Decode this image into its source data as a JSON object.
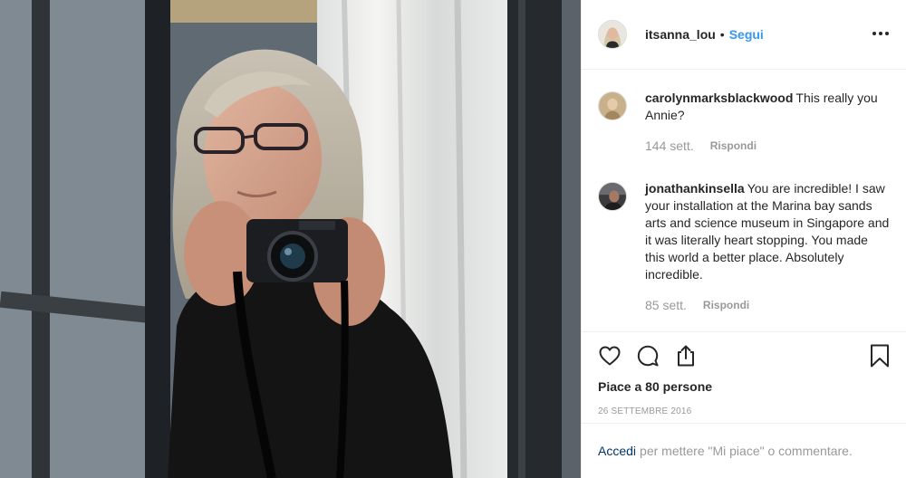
{
  "post": {
    "author": "itsanna_lou",
    "separator": "•",
    "follow_label": "Segui",
    "likes_text": "Piace a 80 persone",
    "date": "26 SETTEMBRE 2016"
  },
  "comments": [
    {
      "username": "carolynmarksblackwood",
      "text": "This really you Annie?",
      "time": "144 sett.",
      "reply_label": "Rispondi"
    },
    {
      "username": "jonathankinsella",
      "text": "You are incredible! I saw your installation at the Marina bay sands arts and science museum in Singapore and it was literally heart stopping. You made this world a better place. Absolutely incredible.",
      "time": "85 sett.",
      "reply_label": "Rispondi"
    }
  ],
  "actions": {
    "like_icon": "heart-icon",
    "comment_icon": "comment-icon",
    "share_icon": "share-icon",
    "save_icon": "bookmark-icon"
  },
  "login_bar": {
    "link_label": "Accedi",
    "rest_text": "per mettere \"Mi piace\" o commentare."
  },
  "colors": {
    "link_blue": "#3897f0",
    "login_link": "#003569",
    "muted_text": "#999999",
    "divider": "#efefef"
  }
}
